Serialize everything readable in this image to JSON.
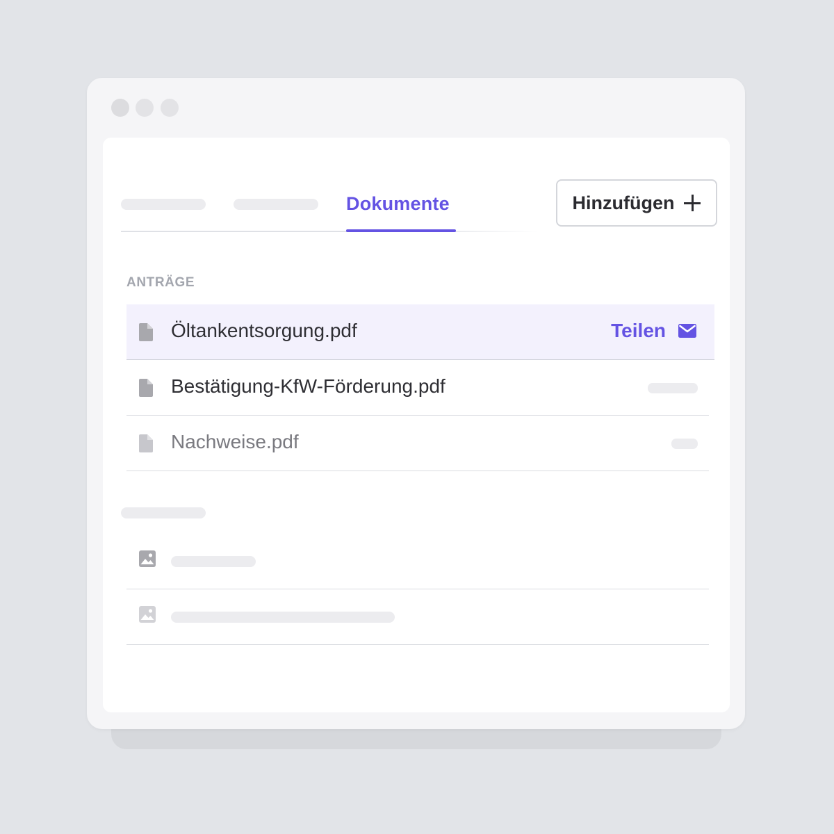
{
  "tabs": {
    "active_label": "Dokumente"
  },
  "toolbar": {
    "add_label": "Hinzufügen"
  },
  "section": {
    "label": "ANTRÄGE"
  },
  "files": [
    {
      "name": "Öltankentsorgung.pdf",
      "action_label": "Teilen"
    },
    {
      "name": "Bestätigung-KfW-Förderung.pdf"
    },
    {
      "name": "Nachweise.pdf"
    }
  ],
  "colors": {
    "accent": "#6453e3",
    "highlight_row": "#f3f1fd",
    "background": "#e2e4e8"
  },
  "icons": {
    "file": "file-icon",
    "mail": "mail-icon",
    "image": "image-icon",
    "plus": "plus-icon"
  }
}
